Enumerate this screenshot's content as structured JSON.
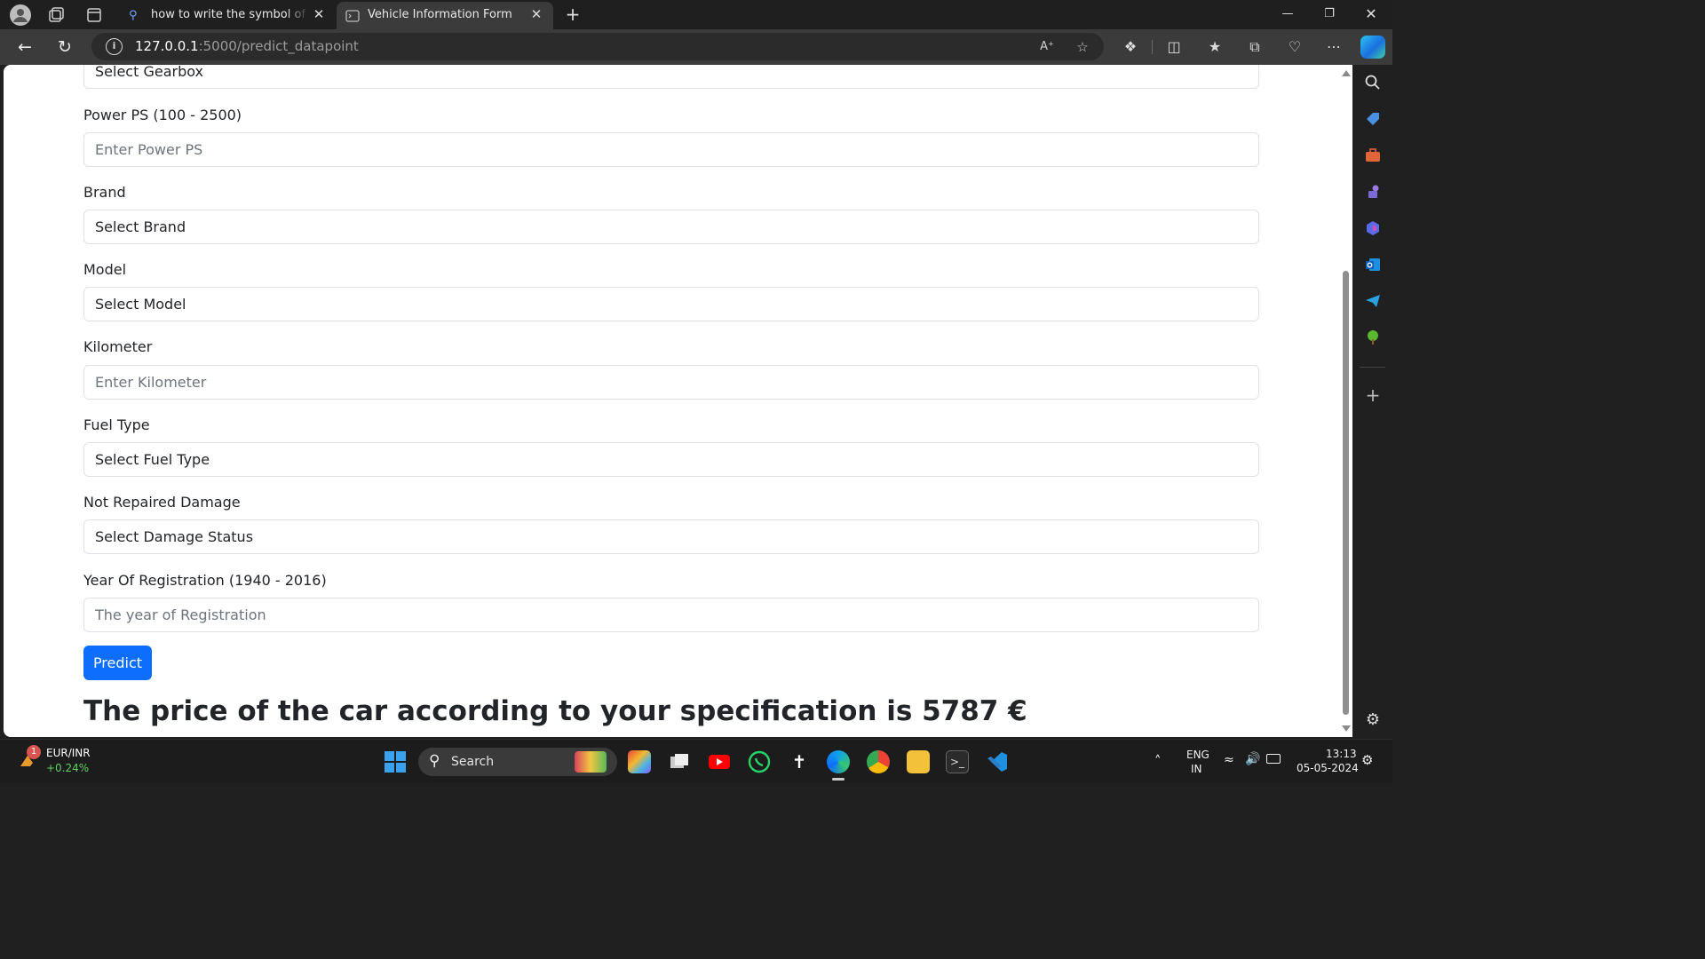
{
  "browser": {
    "tabs": [
      {
        "title": "how to write the symbol of euro",
        "active": false
      },
      {
        "title": "Vehicle Information Form",
        "active": true
      }
    ],
    "url_host": "127.0.0.1",
    "url_rest": ":5000/predict_datapoint"
  },
  "form": {
    "gearbox_select": "Select Gearbox",
    "power_label": "Power PS (100 - 2500)",
    "power_placeholder": "Enter Power PS",
    "brand_label": "Brand",
    "brand_select": "Select Brand",
    "model_label": "Model",
    "model_select": "Select Model",
    "kilometer_label": "Kilometer",
    "kilometer_placeholder": "Enter Kilometer",
    "fuel_label": "Fuel Type",
    "fuel_select": "Select Fuel Type",
    "damage_label": "Not Repaired Damage",
    "damage_select": "Select Damage Status",
    "year_label": "Year Of Registration (1940 - 2016)",
    "year_placeholder": "The year of Registration",
    "predict_label": "Predict",
    "result_text": "The price of the car according to your specification is 5787 €"
  },
  "taskbar": {
    "ticker_name": "EUR/INR",
    "ticker_change": "+0.24%",
    "ticker_badge": "1",
    "search_label": "Search",
    "lang_top": "ENG",
    "lang_bottom": "IN",
    "time": "13:13",
    "date": "05-05-2024"
  },
  "colors": {
    "primary_button": "#0d6efd",
    "page_bg": "#ffffff",
    "chrome_bg": "#1f1f1f"
  }
}
